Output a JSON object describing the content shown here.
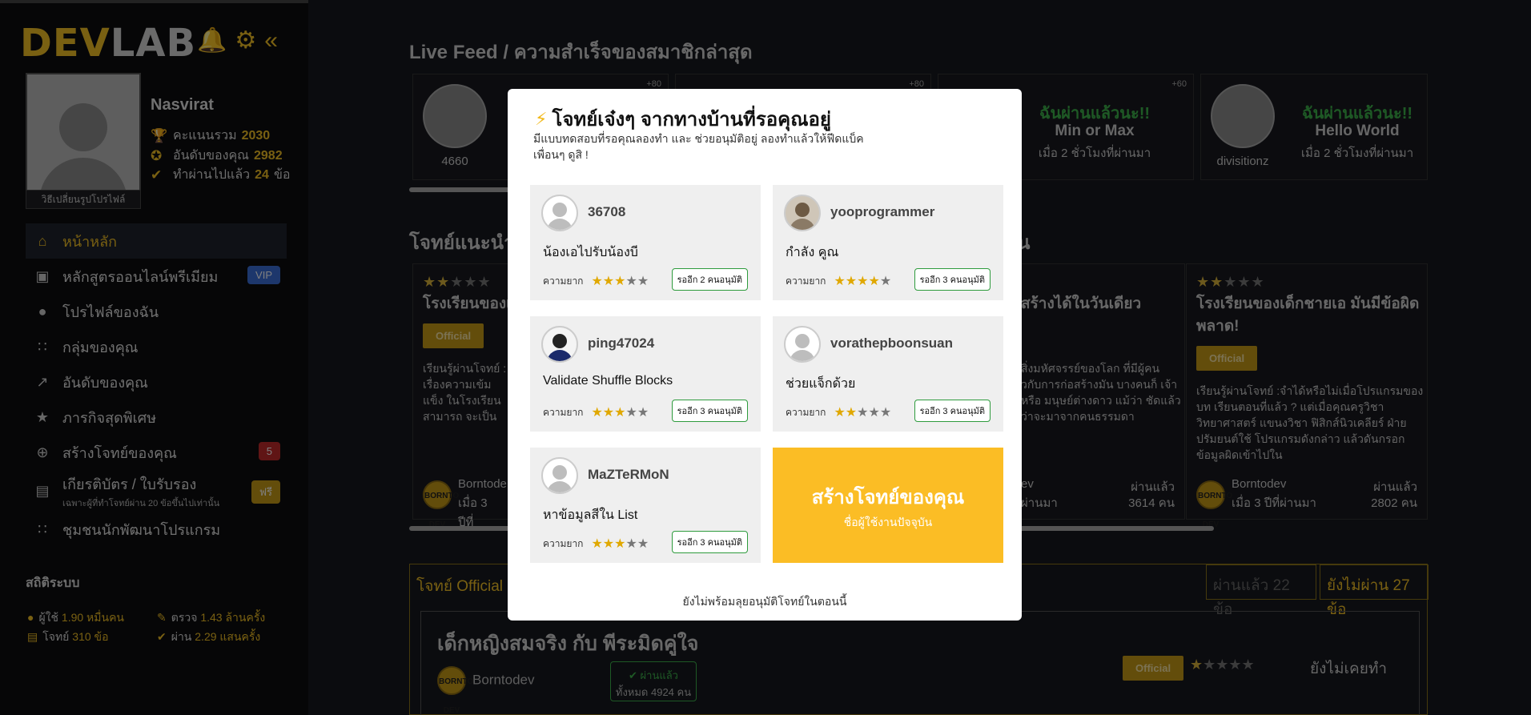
{
  "app": {
    "logo_dev": "DEV",
    "logo_lab": "LAB"
  },
  "sidebar": {
    "icons": [
      "bell-icon",
      "gear-icon",
      "double-chevron-left-icon"
    ],
    "profile": {
      "name": "Nasvirat",
      "change_pic": "วิธีเปลี่ยนรูปโปรไฟล์",
      "score_label": "คะแนนรวม",
      "score": "2030",
      "rank_label": "อันดับของคุณ",
      "rank": "2982",
      "done_label": "ทำผ่านไปแล้ว",
      "done": "24",
      "done_unit": "ข้อ"
    },
    "nav": [
      {
        "label": "หน้าหลัก",
        "icon": "home-icon"
      },
      {
        "label": "หลักสูตรออนไลน์พรีเมียม",
        "icon": "laptop-icon",
        "badge": "VIP"
      },
      {
        "label": "โปรไฟล์ของฉัน",
        "icon": "user-icon"
      },
      {
        "label": "กลุ่มของคุณ",
        "icon": "group-icon"
      },
      {
        "label": "อันดับของคุณ",
        "icon": "trending-icon"
      },
      {
        "label": "ภารกิจสุดพิเศษ",
        "icon": "star-icon"
      },
      {
        "label": "สร้างโจทย์ของคุณ",
        "icon": "plus-circle-icon",
        "badge": "5"
      },
      {
        "label": "เกียรติบัตร / ใบรับรอง",
        "sub": "เฉพาะผู้ที่ทำโจทย์ผ่าน 20 ข้อขึ้นไปเท่านั้น",
        "icon": "certificate-icon",
        "badge": "ฟรี"
      },
      {
        "label": "ชุมชนนักพัฒนาโปรแกรม",
        "icon": "community-icon"
      }
    ],
    "system": {
      "title": "สถิติระบบ",
      "users_label": "ผู้ใช้",
      "users": "1.90 หมื่นคน",
      "checks_label": "ตรวจ",
      "checks": "1.43 ล้านครั้ง",
      "problems_label": "โจทย์",
      "problems": "310 ข้อ",
      "passes_label": "ผ่าน",
      "passes": "2.29 แสนครั้ง"
    }
  },
  "main": {
    "feed_title": "Live Feed / ความสำเร็จของสมาชิกล่าสุด",
    "feed": [
      {
        "name": "4660",
        "plus": "+80",
        "pass": "",
        "task": "",
        "time": ""
      },
      {
        "name": "",
        "plus": "+80",
        "pass": "",
        "task": "",
        "time": ""
      },
      {
        "name": "",
        "plus": "+60",
        "pass": "ฉันผ่านแล้วนะ!!",
        "task": "Min or Max",
        "time": "เมื่อ 2 ชั่วโมงที่ผ่านมา"
      },
      {
        "name": "divisitionz",
        "plus": "",
        "pass": "ฉันผ่านแล้วนะ!!",
        "task": "Hello World",
        "time": "เมื่อ 2 ชั่วโมงที่ผ่านมา"
      }
    ],
    "rec_title": "โจทย์แนะนำ",
    "rec_title_tail": "น",
    "rec": [
      {
        "title": "โรงเรียนของเด็",
        "official": "Official",
        "desc": "เรียนรู้ผ่านโจทย์ : เรื่องความเข้มแข็ง ในโรงเรียนสามารถ จะเป็นเพียงแค่เด็ก",
        "dev": "Borntode",
        "time": "เมื่อ 3 ปีที่",
        "pass_label": "",
        "pass_count": ""
      },
      {
        "title": "สร้างได้ในวันเดียว",
        "official": "",
        "desc": "สิ่งมหัศจรรย์ของโลก ที่มีผู้คน วกับการก่อสร้างมัน บางคนก็ เจ้า หรือ มนุษย์ต่างดาว แม้ว่า ชัดแล้วว่าจะมาจากคนธรรมดา",
        "dev": "ev",
        "time": "ผ่านมา",
        "pass_label": "ผ่านแล้ว",
        "pass_count": "3614 คน"
      },
      {
        "title": "โรงเรียนของเด็กชายเอ มันมีข้อผิดพลาด!",
        "official": "Official",
        "desc": "เรียนรู้ผ่านโจทย์ :จำได้หรือไม่เมื่อโปรแกรมของบท เรียนตอนที่แล้ว ? แต่เมื่อคุณครูวิชาวิทยาศาสตร์ แขนงวิชา ฟิสิกส์นิวเคลียร์ ฝ่ายปรัมยนต์ใช้ โปรแกรมดังกล่าว แล้วดันกรอกข้อมูลผิดเข้าไปใน",
        "dev": "Borntodev",
        "time": "เมื่อ 3 ปีที่ผ่านมา",
        "pass_label": "ผ่านแล้ว",
        "pass_count": "2802 คน"
      }
    ],
    "dev_logo": "BORNTO DEV",
    "official_section": {
      "title": "โจทย์ Official",
      "tab_done": "ผ่านแล้ว 22 ข้อ",
      "tab_todo": "ยังไม่ผ่าน 27 ข้อ",
      "item": {
        "title": "เด็กหญิงสมจริง กับ พีระมิดคู่ใจ",
        "dev": "Borntodev",
        "pass_label": "ผ่านแล้ว",
        "pass_total": "ทั้งหมด 4924 คน",
        "official": "Official",
        "status": "ยังไม่เคยทำ"
      }
    }
  },
  "modal": {
    "title": "โจทย์เจ๋งๆ จากทางบ้านที่รอคุณอยู่",
    "subtitle": "มีแบบทดสอบที่รอคุณลองทำ และ ช่วยอนุมัติอยู่ ลองทำแล้วให้ฟีดแบ็คเพื่อนๆ ดูสิ !",
    "difficulty_label": "ความยาก",
    "challenges": [
      {
        "user": "36708",
        "title": "น้องเอไปรับน้องบี",
        "stars": 3,
        "wait": "รออีก 2 คนอนุมัติ",
        "avatar": "default"
      },
      {
        "user": "yooprogrammer",
        "title": "กำลัง คูณ",
        "stars": 4,
        "wait": "รออีก 3 คนอนุมัติ",
        "avatar": "photo"
      },
      {
        "user": "ping47024",
        "title": "Validate Shuffle Blocks",
        "stars": 3,
        "wait": "รออีก 3 คนอนุมัติ",
        "avatar": "person"
      },
      {
        "user": "vorathepboonsuan",
        "title": "ช่วยแจ็กด้วย",
        "stars": 2,
        "wait": "รออีก 3 คนอนุมัติ",
        "avatar": "default"
      },
      {
        "user": "MaZTeRMoN",
        "title": "หาข้อมูลสีใน List",
        "stars": 3,
        "wait": "รออีก 3 คนอนุมัติ",
        "avatar": "default"
      }
    ],
    "create": {
      "title": "สร้างโจทย์ของคุณ",
      "subtitle": "ชื่อผู้ใช้งานปัจจุบัน"
    },
    "footer": "ยังไม่พร้อมลุยอนุมัติโจทย์ในตอนนี้"
  },
  "colors": {
    "accent": "#f2c025",
    "success": "#3db34a",
    "create_card": "#fbbd25"
  }
}
